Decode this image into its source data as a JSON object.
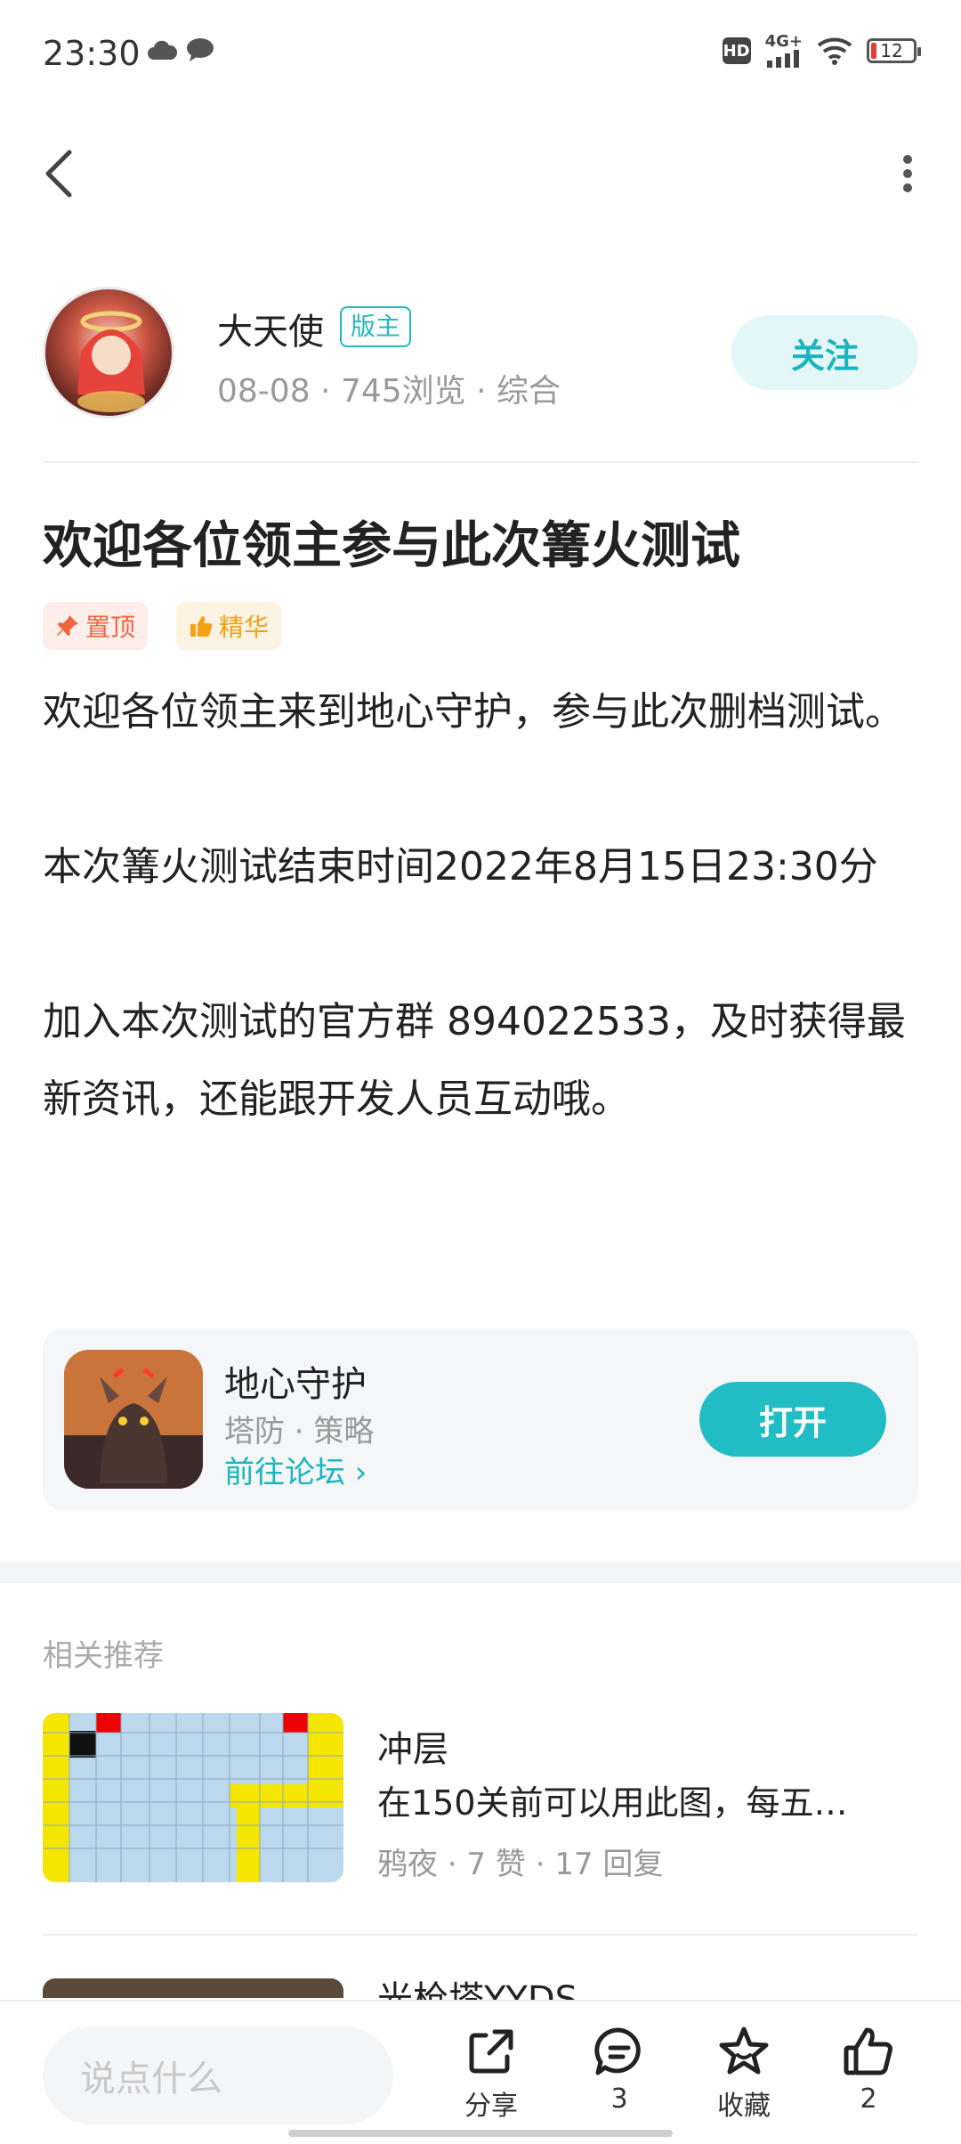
{
  "status": {
    "time": "23:30",
    "network": "4G+",
    "battery": "12"
  },
  "author": {
    "name": "大天使",
    "badge": "版主",
    "meta": "08-08 · 745浏览 · 综合",
    "follow_label": "关注"
  },
  "post": {
    "title": "欢迎各位领主参与此次篝火测试",
    "tags": {
      "pin": "置顶",
      "essence": "精华"
    },
    "paragraphs": [
      "欢迎各位领主来到地心守护，参与此次删档测试。",
      "本次篝火测试结束时间2022年8月15日23:30分",
      "加入本次测试的官方群 894022533，及时获得最新资讯，还能跟开发人员互动哦。"
    ]
  },
  "game_card": {
    "name": "地心守护",
    "tags": "塔防 · 策略",
    "forum_link": "前往论坛 ›",
    "open_label": "打开"
  },
  "related": {
    "title": "相关推荐",
    "items": [
      {
        "title": "冲层",
        "desc": "在150关前可以用此图，每五…",
        "meta": "鸦夜 · 7 赞 · 17 回复"
      },
      {
        "title": "光枪塔YYDS"
      }
    ]
  },
  "bottom_bar": {
    "input_placeholder": "说点什么",
    "share_label": "分享",
    "comment_count": "3",
    "favorite_label": "收藏",
    "like_count": "2"
  },
  "colors": {
    "accent": "#21bcc4",
    "pin": "#f0653f",
    "essence": "#f5a116"
  }
}
